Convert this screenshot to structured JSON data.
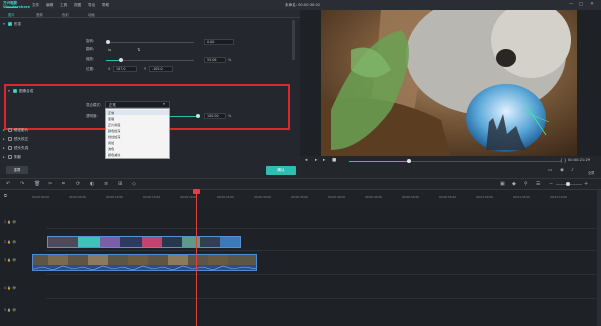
{
  "app": {
    "logo": "万兴喵影\nWondershare",
    "menu": [
      "文件",
      "编辑",
      "工具",
      "视图",
      "导出",
      "帮助"
    ],
    "doc_title": "未命名: 00:00:30:02",
    "win": [
      "—",
      "□",
      "✕"
    ]
  },
  "tabs": [
    "图片",
    "音频",
    "色彩",
    "动画"
  ],
  "transform": {
    "title": "形变",
    "rotate_label": "旋转:",
    "rotate_value": "0.00",
    "flip_label": "翻转:",
    "scale_label": "缩放:",
    "scale_value": "55.06",
    "scale_unit": "%",
    "pos_label": "位置:",
    "x_label": "X",
    "x_value": "187.0",
    "y_label": "Y",
    "y_value": "-105.0"
  },
  "composite": {
    "title": "图像合成",
    "blend_label": "混合模式:",
    "blend_value": "正常",
    "opacity_label": "透明度:",
    "opacity_value": "100.00",
    "opacity_unit": "%",
    "options": [
      "正常",
      "变暗",
      "正片叠底",
      "颜色加深",
      "线性加深",
      "叠加",
      "滤色",
      "颜色减淡"
    ]
  },
  "sections": [
    "稳定影片",
    "镜头校正",
    "镜头失真",
    "阴影"
  ],
  "buttons": {
    "reset": "重置",
    "ok": "确认"
  },
  "player": {
    "timecode": "00:00:21:29",
    "ratio": "全屏"
  },
  "ruler": [
    "00:00:00:00",
    "00:00:05:00",
    "00:00:10:00",
    "00:00:15:00",
    "00:00:20:00",
    "00:00:25:00",
    "00:00:30:00",
    "00:00:35:00",
    "00:00:40:00",
    "00:00:45:00",
    "00:00:50:00",
    "00:00:55:00",
    "00:01:00:00",
    "00:01:05:00",
    "00:01:10:00",
    "00:01:15:00"
  ],
  "tracks": [
    "1",
    "2",
    "3",
    "4",
    "5"
  ],
  "colors": {
    "accent": "#2ebfb3",
    "highlight": "#e0262a",
    "playhead": "#e24141"
  }
}
